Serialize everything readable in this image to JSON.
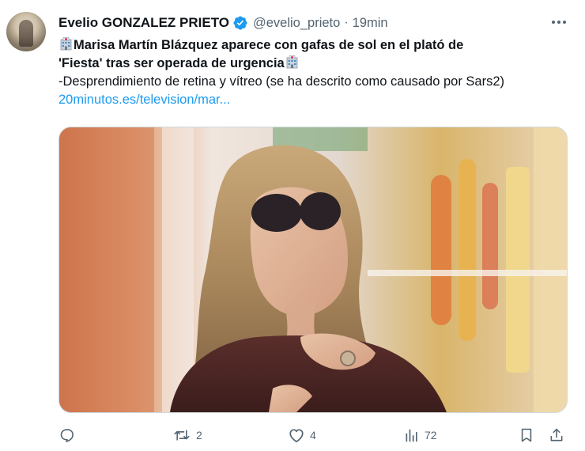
{
  "author": {
    "display_name": "Evelio GONZALEZ PRIETO",
    "handle": "@evelio_prieto",
    "separator": "·",
    "time": "19min",
    "verified_icon": "verified-badge-icon",
    "avatar_icon": "profile-avatar"
  },
  "tweet": {
    "headline_line1": "Marisa Martín Blázquez aparece con gafas de sol en el plató de",
    "headline_line2": "'Fiesta' tras ser operada de urgencia",
    "emoji_icon": "hospital-emoji-icon",
    "body": "-Desprendimiento de retina y vítreo (se ha descrito como causado por Sars2)",
    "link": "20minutos.es/television/mar..."
  },
  "media": {
    "icon": "tv-still-photo",
    "description_visible": ""
  },
  "actions": {
    "reply_count": "",
    "retweet_count": "2",
    "like_count": "4",
    "views_count": "72"
  },
  "colors": {
    "link": "#1d9bf0",
    "verified": "#1d9bf0",
    "muted": "#536471",
    "text": "#0f1419"
  }
}
